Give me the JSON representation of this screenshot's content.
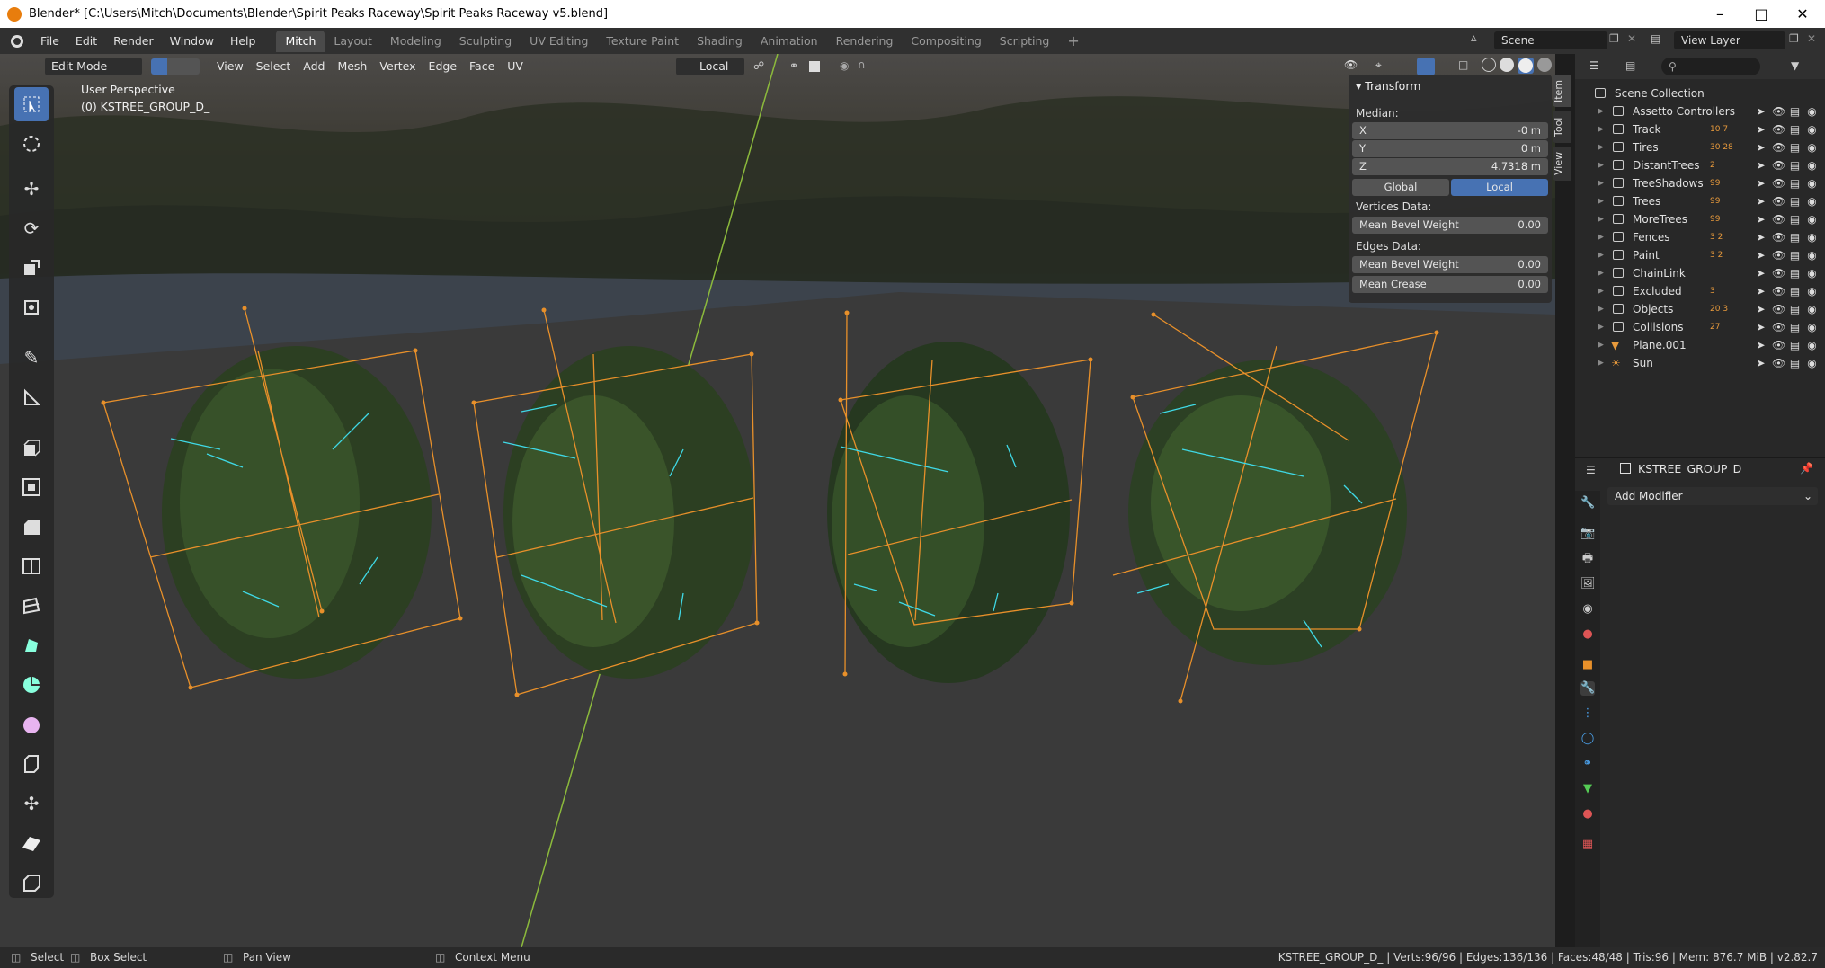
{
  "window": {
    "title": "Blender* [C:\\Users\\Mitch\\Documents\\Blender\\Spirit Peaks Raceway\\Spirit Peaks Raceway v5.blend]"
  },
  "menus": [
    "File",
    "Edit",
    "Render",
    "Window",
    "Help"
  ],
  "workspaces": [
    "Mitch",
    "Layout",
    "Modeling",
    "Sculpting",
    "UV Editing",
    "Texture Paint",
    "Shading",
    "Animation",
    "Rendering",
    "Compositing",
    "Scripting"
  ],
  "active_workspace": "Mitch",
  "scene": {
    "name": "Scene",
    "view_layer": "View Layer"
  },
  "viewport_header": {
    "mode": "Edit Mode",
    "menus": [
      "View",
      "Select",
      "Add",
      "Mesh",
      "Vertex",
      "Edge",
      "Face",
      "UV"
    ],
    "orientation": "Local"
  },
  "viewport": {
    "perspective": "User Perspective",
    "object": "(0) KSTREE_GROUP_D_"
  },
  "tools": [
    "select-box",
    "cursor",
    "move",
    "rotate",
    "scale",
    "transform",
    "annotate",
    "measure",
    "extrude",
    "inset",
    "bevel",
    "loop-cut",
    "knife",
    "poly-build",
    "spin",
    "smooth",
    "shrink-fatten",
    "shear",
    "rip",
    "extrude-to-cursor"
  ],
  "npanel": {
    "title": "Transform",
    "median_label": "Median:",
    "x_label": "X",
    "x": "-0 m",
    "y_label": "Y",
    "y": "0 m",
    "z_label": "Z",
    "z": "4.7318 m",
    "global": "Global",
    "local": "Local",
    "vertices_label": "Vertices Data:",
    "vertex_bevel_label": "Mean Bevel Weight",
    "vertex_bevel": "0.00",
    "edges_label": "Edges Data:",
    "edge_bevel_label": "Mean Bevel Weight",
    "edge_bevel": "0.00",
    "crease_label": "Mean Crease",
    "crease": "0.00",
    "tabs": [
      "Item",
      "Tool",
      "View"
    ]
  },
  "outliner": {
    "root": "Scene Collection",
    "items": [
      {
        "name": "Assetto Controllers",
        "badge": ""
      },
      {
        "name": "Track",
        "badge": "10  7"
      },
      {
        "name": "Tires",
        "badge": "30  28"
      },
      {
        "name": "DistantTrees",
        "badge": "2"
      },
      {
        "name": "TreeShadows",
        "badge": "99"
      },
      {
        "name": "Trees",
        "badge": "99"
      },
      {
        "name": "MoreTrees",
        "badge": "99"
      },
      {
        "name": "Fences",
        "badge": "3  2"
      },
      {
        "name": "Paint",
        "badge": "3  2"
      },
      {
        "name": "ChainLink",
        "badge": ""
      },
      {
        "name": "Excluded",
        "badge": "3"
      },
      {
        "name": "Objects",
        "badge": "20  3"
      },
      {
        "name": "Collisions",
        "badge": "27"
      },
      {
        "name": "Plane.001",
        "badge": ""
      },
      {
        "name": "Sun",
        "badge": ""
      }
    ]
  },
  "properties": {
    "object": "KSTREE_GROUP_D_",
    "add_modifier": "Add Modifier"
  },
  "statusbar": {
    "select": "Select",
    "box_select": "Box Select",
    "pan_view": "Pan View",
    "context_menu": "Context Menu",
    "stats": "KSTREE_GROUP_D_ | Verts:96/96 | Edges:136/136 | Faces:48/48 | Tris:96 | Mem: 876.7 MiB | v2.82.7"
  },
  "colors": {
    "accent": "#4772b3",
    "selected_edge": "#e8902a",
    "normal": "#3fd9e6",
    "y_axis": "#8cba3c"
  }
}
